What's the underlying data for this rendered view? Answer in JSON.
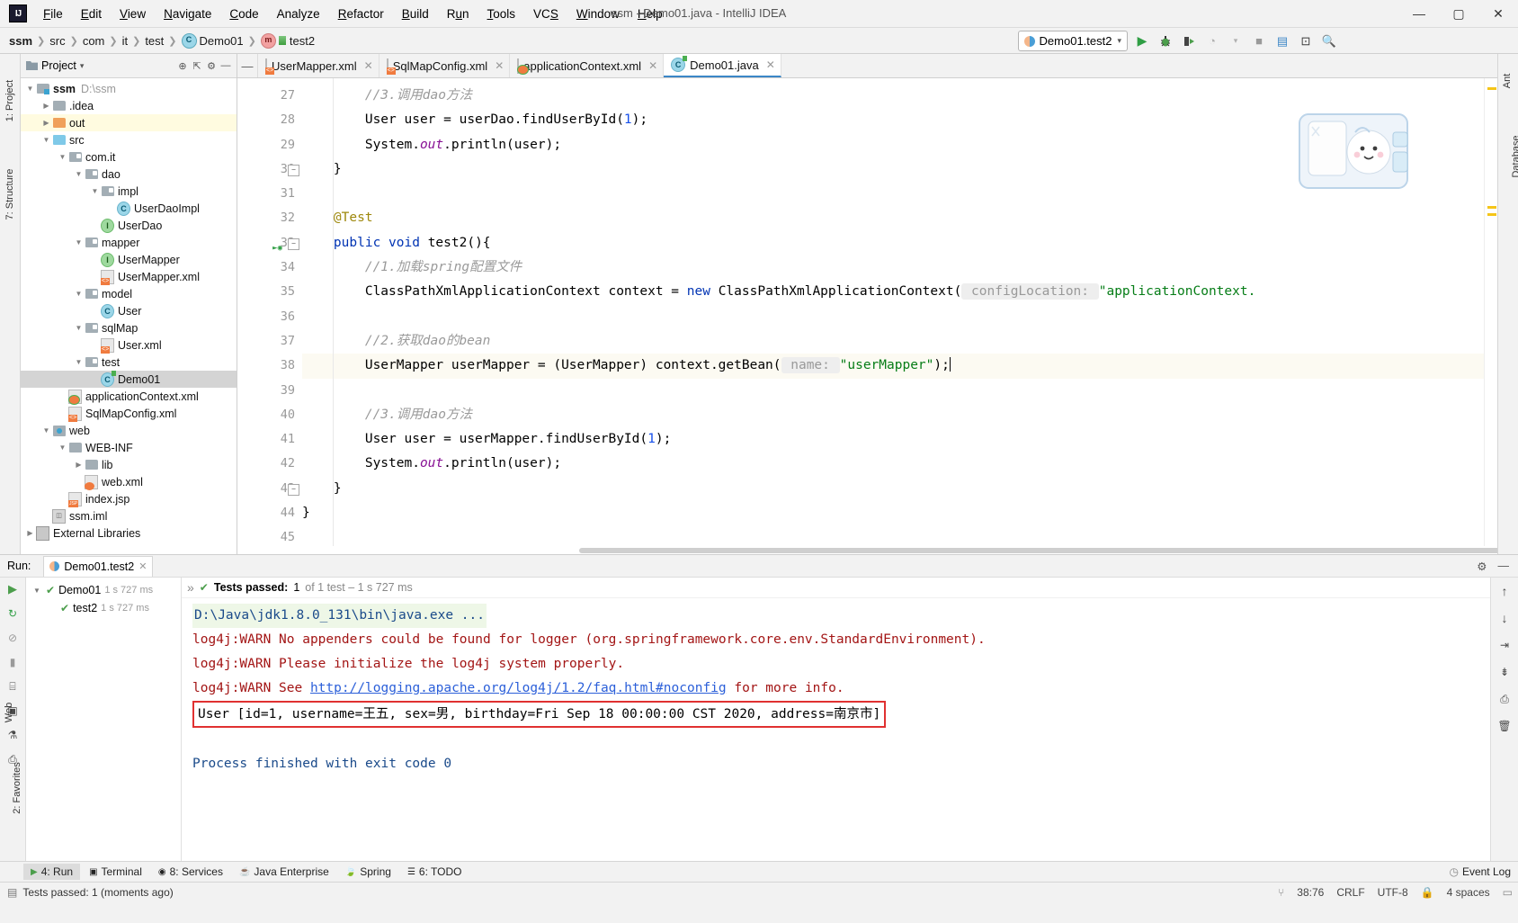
{
  "window": {
    "title": "ssm - Demo01.java - IntelliJ IDEA",
    "logo": "IJ",
    "minimize": "—",
    "maximize": "▢",
    "close": "✕"
  },
  "menu": [
    "File",
    "Edit",
    "View",
    "Navigate",
    "Code",
    "Analyze",
    "Refactor",
    "Build",
    "Run",
    "Tools",
    "VCS",
    "Window",
    "Help"
  ],
  "breadcrumb": [
    "ssm",
    "src",
    "com",
    "it",
    "test",
    "Demo01",
    "test2"
  ],
  "run_widget": {
    "config": "Demo01.test2",
    "dropdown": "▾",
    "run": "▶",
    "debug": "debug-icon",
    "run_coverage": "coverage-icon",
    "profile": "profile-icon"
  },
  "project_panel": {
    "title": "Project",
    "dropdown": "▾",
    "tree": [
      {
        "depth": 0,
        "twisty": "▼",
        "icon": "module",
        "label": "ssm",
        "bold": true,
        "path": "D:\\ssm",
        "state": "normal"
      },
      {
        "depth": 1,
        "twisty": "▶",
        "icon": "folder-gray",
        "label": ".idea",
        "state": "normal"
      },
      {
        "depth": 1,
        "twisty": "▶",
        "icon": "folder-orange",
        "label": "out",
        "state": "highlight"
      },
      {
        "depth": 1,
        "twisty": "▼",
        "icon": "folder-blue",
        "label": "src",
        "state": "normal"
      },
      {
        "depth": 2,
        "twisty": "▼",
        "icon": "package",
        "label": "com.it",
        "state": "normal"
      },
      {
        "depth": 3,
        "twisty": "▼",
        "icon": "package",
        "label": "dao",
        "state": "normal"
      },
      {
        "depth": 4,
        "twisty": "▼",
        "icon": "package",
        "label": "impl",
        "state": "normal"
      },
      {
        "depth": 5,
        "twisty": "",
        "icon": "class",
        "label": "UserDaoImpl",
        "state": "normal"
      },
      {
        "depth": 4,
        "twisty": "",
        "icon": "interface",
        "label": "UserDao",
        "state": "normal"
      },
      {
        "depth": 3,
        "twisty": "▼",
        "icon": "package",
        "label": "mapper",
        "state": "normal"
      },
      {
        "depth": 4,
        "twisty": "",
        "icon": "interface",
        "label": "UserMapper",
        "state": "normal"
      },
      {
        "depth": 4,
        "twisty": "",
        "icon": "xml",
        "label": "UserMapper.xml",
        "state": "normal"
      },
      {
        "depth": 3,
        "twisty": "▼",
        "icon": "package",
        "label": "model",
        "state": "normal"
      },
      {
        "depth": 4,
        "twisty": "",
        "icon": "class",
        "label": "User",
        "state": "normal"
      },
      {
        "depth": 3,
        "twisty": "▼",
        "icon": "package",
        "label": "sqlMap",
        "state": "normal"
      },
      {
        "depth": 4,
        "twisty": "",
        "icon": "xml",
        "label": "User.xml",
        "state": "normal"
      },
      {
        "depth": 3,
        "twisty": "▼",
        "icon": "package",
        "label": "test",
        "state": "normal"
      },
      {
        "depth": 4,
        "twisty": "",
        "icon": "class-test",
        "label": "Demo01",
        "state": "selected"
      },
      {
        "depth": 2,
        "twisty": "",
        "icon": "xml-spring",
        "label": "applicationContext.xml",
        "state": "normal"
      },
      {
        "depth": 2,
        "twisty": "",
        "icon": "xml",
        "label": "SqlMapConfig.xml",
        "state": "normal"
      },
      {
        "depth": 1,
        "twisty": "▼",
        "icon": "web",
        "label": "web",
        "state": "normal"
      },
      {
        "depth": 2,
        "twisty": "▼",
        "icon": "folder-gray",
        "label": "WEB-INF",
        "state": "normal"
      },
      {
        "depth": 3,
        "twisty": "▶",
        "icon": "folder-gray",
        "label": "lib",
        "state": "normal"
      },
      {
        "depth": 3,
        "twisty": "",
        "icon": "xml-web",
        "label": "web.xml",
        "state": "normal"
      },
      {
        "depth": 2,
        "twisty": "",
        "icon": "jsp",
        "label": "index.jsp",
        "state": "normal"
      },
      {
        "depth": 1,
        "twisty": "",
        "icon": "iml",
        "label": "ssm.iml",
        "state": "normal"
      },
      {
        "depth": 0,
        "twisty": "▶",
        "icon": "library",
        "label": "External Libraries",
        "state": "normal"
      }
    ]
  },
  "left_strip": [
    "1: Project",
    "7: Structure"
  ],
  "left_strip_bottom": [
    "Web",
    "2: Favorites"
  ],
  "right_strip": [
    "Ant",
    "Database"
  ],
  "editor_tabs": [
    {
      "label": "UserMapper.xml",
      "icon": "xml",
      "active": false,
      "close": "✕"
    },
    {
      "label": "SqlMapConfig.xml",
      "icon": "xml",
      "active": false,
      "close": "✕"
    },
    {
      "label": "applicationContext.xml",
      "icon": "xml-spring",
      "active": false,
      "close": "✕"
    },
    {
      "label": "Demo01.java",
      "icon": "class-test",
      "active": true,
      "close": "✕"
    }
  ],
  "editor": {
    "first_line": 27,
    "lines": [
      {
        "n": 27,
        "segments": [
          {
            "t": "        ",
            "c": ""
          },
          {
            "t": "//3.调用dao方法",
            "c": "cmt"
          }
        ]
      },
      {
        "n": 28,
        "segments": [
          {
            "t": "        User user = userDao.findUserById(",
            "c": ""
          },
          {
            "t": "1",
            "c": "num"
          },
          {
            "t": ");",
            "c": ""
          }
        ]
      },
      {
        "n": 29,
        "segments": [
          {
            "t": "        System.",
            "c": ""
          },
          {
            "t": "out",
            "c": "fld"
          },
          {
            "t": ".println(user);",
            "c": ""
          }
        ]
      },
      {
        "n": 30,
        "segments": [
          {
            "t": "    }",
            "c": ""
          }
        ],
        "fold": true
      },
      {
        "n": 31,
        "segments": [
          {
            "t": "",
            "c": ""
          }
        ]
      },
      {
        "n": 32,
        "segments": [
          {
            "t": "    ",
            "c": ""
          },
          {
            "t": "@Test",
            "c": "anno"
          }
        ]
      },
      {
        "n": 33,
        "segments": [
          {
            "t": "    ",
            "c": ""
          },
          {
            "t": "public",
            "c": "kw"
          },
          {
            "t": " ",
            "c": ""
          },
          {
            "t": "void",
            "c": "kw"
          },
          {
            "t": " test2(){",
            "c": ""
          }
        ],
        "fold": true,
        "runmark": true
      },
      {
        "n": 34,
        "segments": [
          {
            "t": "        ",
            "c": ""
          },
          {
            "t": "//1.加载spring配置文件",
            "c": "cmt"
          }
        ]
      },
      {
        "n": 35,
        "segments": [
          {
            "t": "        ClassPathXmlApplicationContext context = ",
            "c": ""
          },
          {
            "t": "new",
            "c": "kw"
          },
          {
            "t": " ClassPathXmlApplicationContext(",
            "c": ""
          },
          {
            "t": " configLocation: ",
            "c": "hintbg"
          },
          {
            "t": "\"applicationContext.",
            "c": "str"
          }
        ]
      },
      {
        "n": 36,
        "segments": [
          {
            "t": "",
            "c": ""
          }
        ]
      },
      {
        "n": 37,
        "segments": [
          {
            "t": "        ",
            "c": ""
          },
          {
            "t": "//2.获取dao的bean",
            "c": "cmt"
          }
        ]
      },
      {
        "n": 38,
        "segments": [
          {
            "t": "        UserMapper userMapper = (UserMapper) context.getBean(",
            "c": ""
          },
          {
            "t": " name: ",
            "c": "hintbg"
          },
          {
            "t": "\"userMapper\"",
            "c": "str"
          },
          {
            "t": ");",
            "c": ""
          }
        ],
        "current": true,
        "caret": true
      },
      {
        "n": 39,
        "segments": [
          {
            "t": "",
            "c": ""
          }
        ]
      },
      {
        "n": 40,
        "segments": [
          {
            "t": "        ",
            "c": ""
          },
          {
            "t": "//3.调用dao方法",
            "c": "cmt"
          }
        ]
      },
      {
        "n": 41,
        "segments": [
          {
            "t": "        User user = userMapper.findUserById(",
            "c": ""
          },
          {
            "t": "1",
            "c": "num"
          },
          {
            "t": ");",
            "c": ""
          }
        ]
      },
      {
        "n": 42,
        "segments": [
          {
            "t": "        System.",
            "c": ""
          },
          {
            "t": "out",
            "c": "fld"
          },
          {
            "t": ".println(user);",
            "c": ""
          }
        ]
      },
      {
        "n": 43,
        "segments": [
          {
            "t": "    }",
            "c": ""
          }
        ],
        "fold": true
      },
      {
        "n": 44,
        "segments": [
          {
            "t": "}",
            "c": ""
          }
        ]
      },
      {
        "n": 45,
        "segments": [
          {
            "t": "",
            "c": ""
          }
        ]
      }
    ]
  },
  "run_panel": {
    "label": "Run:",
    "tab": "Demo01.test2",
    "tab_close": "✕",
    "status": {
      "prefix": "Tests passed:",
      "count": "1",
      "suffix": "of 1 test – 1 s 727 ms",
      "check": "✔"
    },
    "test_tree": [
      {
        "depth": 0,
        "twisty": "▼",
        "label": "Demo01",
        "time": "1 s 727 ms"
      },
      {
        "depth": 1,
        "twisty": "",
        "label": "test2",
        "time": "1 s 727 ms"
      }
    ],
    "console": [
      {
        "text": "D:\\Java\\jdk1.8.0_131\\bin\\java.exe ...",
        "style": "cmdline"
      },
      {
        "text": "log4j:WARN No appenders could be found for logger (org.springframework.core.env.StandardEnvironment).",
        "style": "warn"
      },
      {
        "text": "log4j:WARN Please initialize the log4j system properly.",
        "style": "warn"
      },
      {
        "text": "log4j:WARN See ",
        "style": "warn",
        "link": "http://logging.apache.org/log4j/1.2/faq.html#noconfig",
        "after": " for more info."
      },
      {
        "text": "User [id=1, username=王五, sex=男, birthday=Fri Sep 18 00:00:00 CST 2020, address=南京市]",
        "style": "boxed"
      },
      {
        "text": "",
        "style": "plain"
      },
      {
        "text": "Process finished with exit code 0",
        "style": "info"
      }
    ],
    "settings_icon": "⚙",
    "minimize_icon": "—"
  },
  "bottom_toolbar": [
    {
      "label": "4: Run",
      "icon": "▶",
      "active": true
    },
    {
      "label": "Terminal",
      "icon": "terminal-icon",
      "active": false
    },
    {
      "label": "8: Services",
      "icon": "services-icon",
      "active": false
    },
    {
      "label": "Java Enterprise",
      "icon": "java-icon",
      "active": false
    },
    {
      "label": "Spring",
      "icon": "spring-icon",
      "active": false
    },
    {
      "label": "6: TODO",
      "icon": "todo-icon",
      "active": false
    }
  ],
  "event_log": "Event Log",
  "status_bar": {
    "message": "Tests passed: 1 (moments ago)",
    "caret": "38:76",
    "line_sep": "CRLF",
    "encoding": "UTF-8",
    "indent": "4 spaces",
    "lock_icon": "lock-icon",
    "branch_icon": "branch-icon"
  },
  "colors": {
    "accent": "#3c87c7",
    "green": "#4c9e4c",
    "warn_red": "#a31515",
    "box_red": "#e03131",
    "link_blue": "#2b5fd9",
    "keyword_blue": "#0033b3",
    "string_green": "#067d17"
  }
}
